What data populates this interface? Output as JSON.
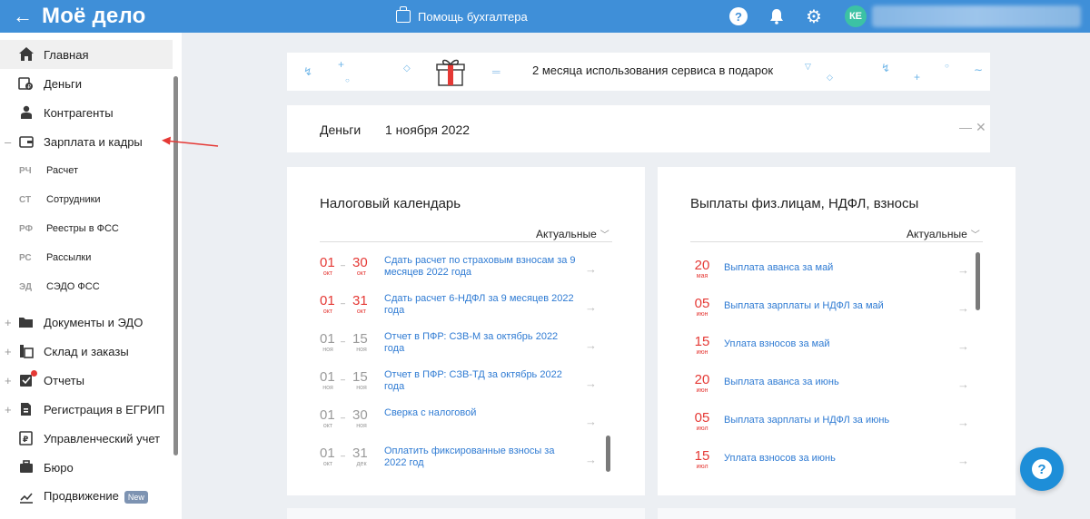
{
  "header": {
    "back_icon": "arrow-left-icon",
    "logo": "Моё дело",
    "assistant_label": "Помощь бухгалтера",
    "avatar_initials": "КЕ",
    "accent_color": "#3f8fd8"
  },
  "sidebar": {
    "items": [
      {
        "label": "Главная",
        "icon": "home-icon"
      },
      {
        "label": "Деньги",
        "icon": "money-icon"
      },
      {
        "label": "Контрагенты",
        "icon": "contractors-icon"
      },
      {
        "label": "Зарплата и кадры",
        "icon": "wallet-icon",
        "toggle": "–"
      },
      {
        "label": "Документы и ЭДО",
        "icon": "folder-icon",
        "toggle": "+"
      },
      {
        "label": "Склад и заказы",
        "icon": "warehouse-icon",
        "toggle": "+"
      },
      {
        "label": "Отчеты",
        "icon": "reports-icon",
        "toggle": "+"
      },
      {
        "label": "Регистрация в ЕГРИП",
        "icon": "registration-icon",
        "toggle": "+"
      },
      {
        "label": "Управленческий учет",
        "icon": "ruble-icon"
      },
      {
        "label": "Бюро",
        "icon": "briefcase-icon"
      },
      {
        "label": "Продвижение",
        "icon": "chart-icon",
        "badge": "New"
      }
    ],
    "subitems": [
      {
        "abbr": "РЧ",
        "label": "Расчет"
      },
      {
        "abbr": "СТ",
        "label": "Сотрудники"
      },
      {
        "abbr": "РФ",
        "label": "Реестры в ФСС"
      },
      {
        "abbr": "РС",
        "label": "Рассылки"
      },
      {
        "abbr": "ЭД",
        "label": "СЭДО ФСС"
      }
    ]
  },
  "promo": {
    "text": "2 месяца использования сервиса в подарок"
  },
  "money": {
    "title": "Деньги",
    "date": "1 ноября 2022",
    "minimize": "—",
    "close": "✕"
  },
  "tax_calendar": {
    "title": "Налоговый календарь",
    "filter": "Актуальные",
    "rows": [
      {
        "from_day": "01",
        "from_month": "окт",
        "to_day": "30",
        "to_month": "окт",
        "color": "red",
        "text": "Сдать расчет по страховым взносам за 9 месяцев 2022 года"
      },
      {
        "from_day": "01",
        "from_month": "окт",
        "to_day": "31",
        "to_month": "окт",
        "color": "red",
        "text": "Сдать расчет 6-НДФЛ за 9 месяцев 2022 года"
      },
      {
        "from_day": "01",
        "from_month": "ноя",
        "to_day": "15",
        "to_month": "ноя",
        "color": "gray",
        "text": "Отчет в ПФР: СЗВ-М за октябрь 2022 года"
      },
      {
        "from_day": "01",
        "from_month": "ноя",
        "to_day": "15",
        "to_month": "ноя",
        "color": "gray",
        "text": "Отчет в ПФР: СЗВ-ТД за октябрь 2022 года"
      },
      {
        "from_day": "01",
        "from_month": "окт",
        "to_day": "30",
        "to_month": "ноя",
        "color": "gray",
        "text": "Сверка с налоговой"
      },
      {
        "from_day": "01",
        "from_month": "окт",
        "to_day": "31",
        "to_month": "дек",
        "color": "gray",
        "text": "Оплатить фиксированные взносы за 2022 год"
      }
    ]
  },
  "payments": {
    "title": "Выплаты физ.лицам, НДФЛ, взносы",
    "filter": "Актуальные",
    "rows": [
      {
        "day": "20",
        "month": "мая",
        "text": "Выплата аванса за май"
      },
      {
        "day": "05",
        "month": "июн",
        "text": "Выплата зарплаты и НДФЛ за май"
      },
      {
        "day": "15",
        "month": "июн",
        "text": "Уплата взносов за май"
      },
      {
        "day": "20",
        "month": "июн",
        "text": "Выплата аванса за июнь"
      },
      {
        "day": "05",
        "month": "июл",
        "text": "Выплата зарплаты и НДФЛ за июнь"
      },
      {
        "day": "15",
        "month": "июл",
        "text": "Уплата взносов за июнь"
      }
    ]
  },
  "help_fab": {
    "label": "?",
    "icon": "help-icon"
  }
}
